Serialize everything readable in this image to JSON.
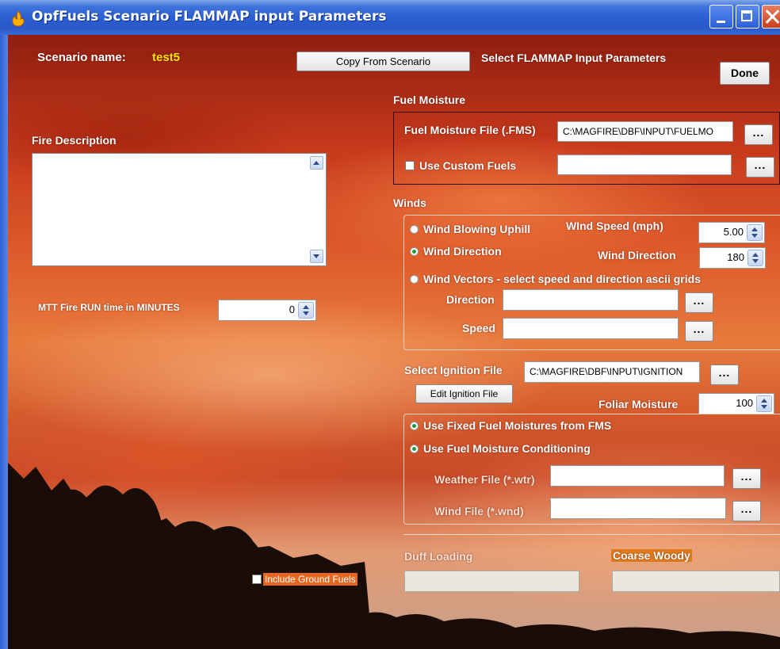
{
  "window": {
    "title": "OpfFuels Scenario FLAMMAP input Parameters",
    "icon": "flame-app-icon"
  },
  "header": {
    "scenario_label": "Scenario name:",
    "scenario_value": "test5",
    "copy_button": "Copy From Scenario",
    "section_title": "Select FLAMMAP Input Parameters",
    "done_button": "Done"
  },
  "left": {
    "fire_description_label": "Fire Description",
    "fire_description_value": "",
    "mtt_label": "MTT Fire RUN time in MINUTES",
    "mtt_value": "0",
    "include_ground_fuels_label": "Include Ground Fuels",
    "include_ground_fuels_checked": false
  },
  "fuel_moisture": {
    "heading": "Fuel Moisture",
    "file_label": "Fuel Moisture File (.FMS)",
    "file_value": "C:\\MAGFIRE\\DBF\\INPUT\\FUELMO",
    "browse": "...",
    "custom_label": "Use Custom Fuels",
    "custom_checked": false,
    "custom_value": ""
  },
  "winds": {
    "heading": "Winds",
    "opt_uphill": "Wind Blowing Uphill",
    "opt_direction": "Wind Direction",
    "opt_vectors": "Wind Vectors - select speed and direction ascii grids",
    "selected": "Wind Direction",
    "speed_label": "WInd Speed (mph)",
    "speed_value": "5.00",
    "direction_label": "Wind Direction",
    "direction_value": "180",
    "vec_direction_label": "Direction",
    "vec_direction_value": "",
    "vec_speed_label": "Speed",
    "vec_speed_value": "",
    "browse": "..."
  },
  "ignition": {
    "label": "Select Ignition File",
    "value": "C:\\MAGFIRE\\DBF\\INPUT\\IGNITION",
    "edit_button": "Edit Ignition File",
    "foliar_label": "Foliar Moisture",
    "foliar_value": "100",
    "browse": "..."
  },
  "conditioning": {
    "opt_fixed": "Use Fixed Fuel Moistures from FMS",
    "opt_conditioning": "Use Fuel Moisture Conditioning",
    "weather_label": "Weather File (*.wtr)",
    "weather_value": "",
    "wind_file_label": "Wind File (*.wnd)",
    "wind_file_value": "",
    "browse": "..."
  },
  "ground": {
    "duff_label": "Duff Loading",
    "duff_value": "",
    "coarse_label": "Coarse Woody",
    "coarse_value": ""
  },
  "colors": {
    "title_bar": "#2b5fd3",
    "label_white": "#ffffff",
    "scenario_value": "#ffe600",
    "radio_selected": "#1e9a3a",
    "orange_tag": "#e07a1c"
  }
}
